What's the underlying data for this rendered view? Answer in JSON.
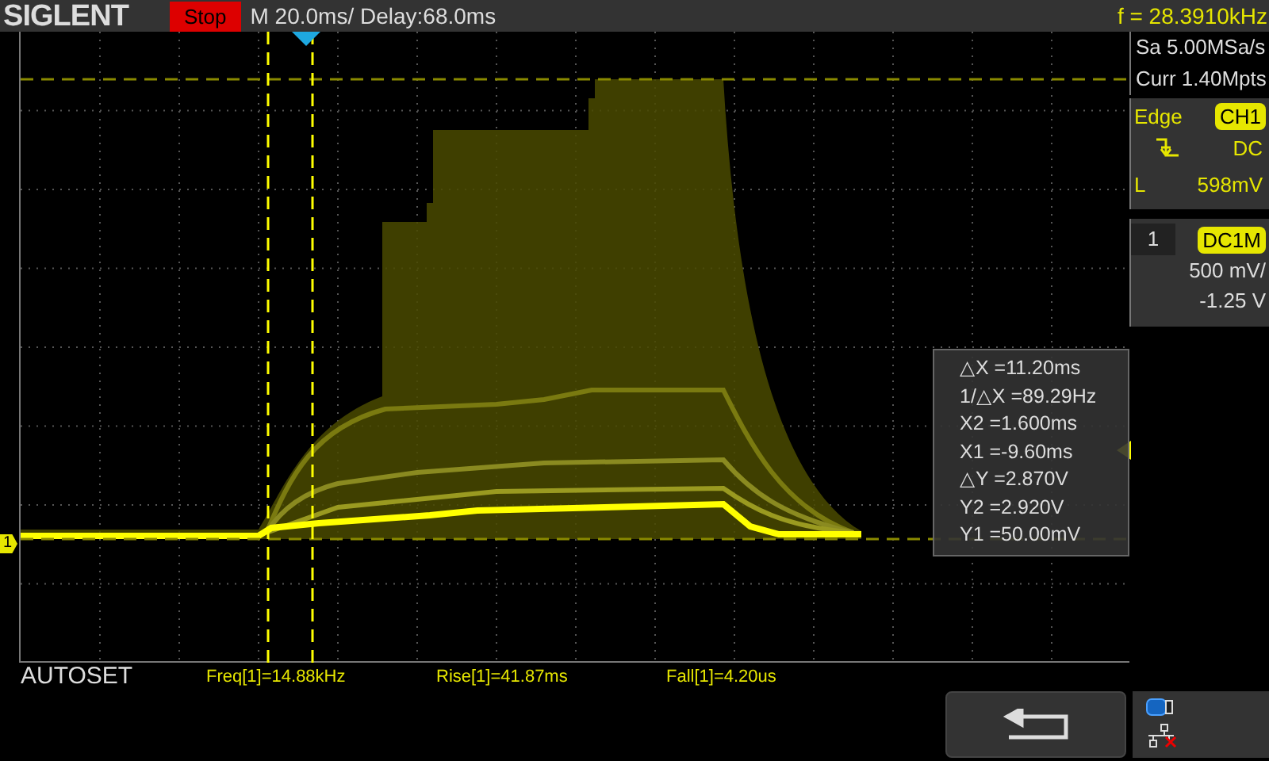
{
  "header": {
    "brand": "SIGLENT",
    "run_state": "Stop",
    "timebase": "M 20.0ms/ Delay:68.0ms",
    "frequency": "f = 28.3910kHz"
  },
  "acquisition": {
    "sample_rate": "Sa 5.00MSa/s",
    "memory": "Curr 1.40Mpts"
  },
  "trigger": {
    "type": "Edge",
    "source": "CH1",
    "coupling": "DC",
    "level_label": "L",
    "level": "598mV"
  },
  "channel": {
    "number": "1",
    "coupling": "DC1M",
    "scale": "500 mV/",
    "offset": "-1.25 V"
  },
  "channel_marker": "1",
  "cursor_readout": [
    "△X =11.20ms",
    "1/△X =89.29Hz",
    "X2 =1.600ms",
    "X1 =-9.60ms",
    "△Y =2.870V",
    "Y2 =2.920V",
    "Y1 =50.00mV"
  ],
  "autoset": "AUTOSET",
  "measurements": [
    "Freq[1]=14.88kHz",
    "Rise[1]=41.87ms",
    "Fall[1]=4.20us"
  ]
}
